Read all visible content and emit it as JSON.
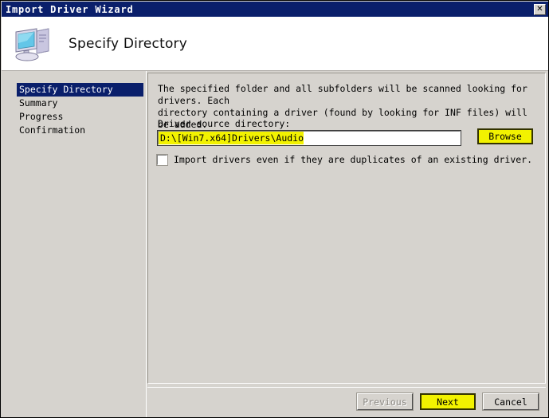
{
  "window": {
    "title": "Import Driver Wizard",
    "close_label": "✕"
  },
  "header": {
    "title": "Specify Directory",
    "icon": "computer-icon"
  },
  "sidebar": {
    "steps": [
      {
        "label": "Specify Directory",
        "active": true
      },
      {
        "label": "Summary",
        "active": false
      },
      {
        "label": "Progress",
        "active": false
      },
      {
        "label": "Confirmation",
        "active": false
      }
    ]
  },
  "main": {
    "description": "The specified folder and all subfolders will be scanned looking for drivers.  Each\ndirectory containing a driver (found by looking for INF files) will be added.",
    "field_label": "Driver source directory:",
    "path_value": "D:\\[Win7.x64]Drivers\\Audio",
    "path_placeholder": "Driver source directory",
    "browse_label": "Browse",
    "checkbox_label": "Import drivers even if they are duplicates of an existing driver.",
    "checkbox_checked": false
  },
  "footer": {
    "previous_label": "Previous",
    "next_label": "Next",
    "cancel_label": "Cancel"
  },
  "colors": {
    "titlebar": "#0a1f6b",
    "highlight_yellow": "#f2f200",
    "dialog_face": "#d6d3ce",
    "selection_blue": "#0a1f6b"
  }
}
